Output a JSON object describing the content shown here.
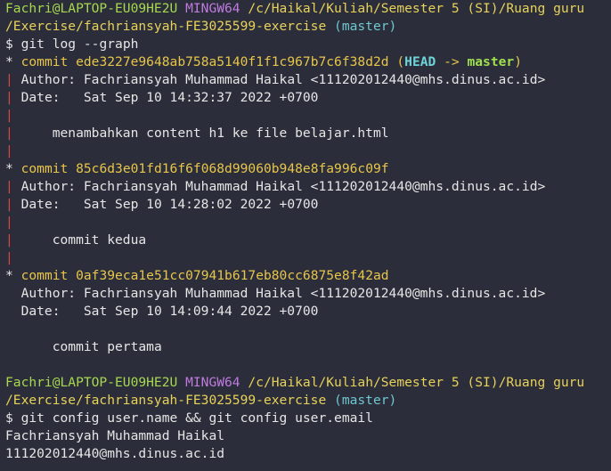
{
  "prompt1": {
    "user_host": "Fachri@LAPTOP-EU09HE2U",
    "shell": "MINGW64",
    "path_line1": "/c/Haikal/Kuliah/Semester 5 (SI)/Ruang guru",
    "path_line2": "/Exercise/fachriansyah-FE3025599-exercise",
    "branch": "(master)",
    "symbol": "$",
    "command": "git log --graph"
  },
  "commits": [
    {
      "star": "*",
      "label": "commit",
      "hash": "ede3227e9648ab758a5140f1f1c967b7c6f38d2d",
      "ref_open": "(",
      "head": "HEAD",
      "arrow": "->",
      "ref_branch": "master",
      "ref_close": ")",
      "author": "Author: Fachriansyah Muhammad Haikal <111202012440@mhs.dinus.ac.id>",
      "date": "Date:   Sat Sep 10 14:32:37 2022 +0700",
      "message": "menambahkan content h1 ke file belajar.html"
    },
    {
      "star": "*",
      "label": "commit",
      "hash": "85c6d3e01fd16f6f068d99060b948e8fa996c09f",
      "author": "Author: Fachriansyah Muhammad Haikal <111202012440@mhs.dinus.ac.id>",
      "date": "Date:   Sat Sep 10 14:28:02 2022 +0700",
      "message": "commit kedua"
    },
    {
      "star": "*",
      "label": "commit",
      "hash": "0af39eca1e51cc07941b617eb80cc6875e8f42ad",
      "author": "Author: Fachriansyah Muhammad Haikal <111202012440@mhs.dinus.ac.id>",
      "date": "Date:   Sat Sep 10 14:09:44 2022 +0700",
      "message": "commit pertama"
    }
  ],
  "graph_char": "|",
  "prompt2": {
    "user_host": "Fachri@LAPTOP-EU09HE2U",
    "shell": "MINGW64",
    "path_line1": "/c/Haikal/Kuliah/Semester 5 (SI)/Ruang guru",
    "path_line2": "/Exercise/fachriansyah-FE3025599-exercise",
    "branch": "(master)",
    "symbol": "$",
    "command": "git config user.name && git config user.email"
  },
  "output": {
    "name": "Fachriansyah Muhammad Haikal",
    "email": "111202012440@mhs.dinus.ac.id"
  },
  "colors": {
    "background": "#2b2d3a",
    "prompt_user": "#a7d84f",
    "prompt_shell": "#c07be0",
    "prompt_path": "#e7d25a",
    "prompt_branch": "#6fc7cf",
    "commit_hash": "#e7c64a",
    "graph_line": "#d9463d"
  }
}
